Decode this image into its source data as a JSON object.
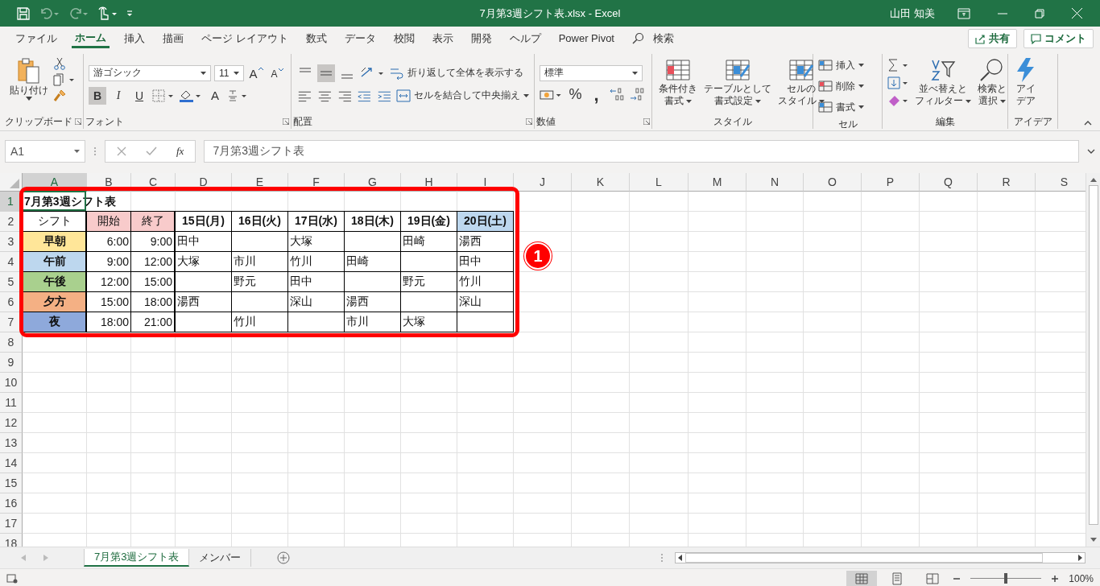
{
  "title_bar": {
    "title": "7月第3週シフト表.xlsx  -  Excel",
    "user": "山田 知美"
  },
  "menu_tabs": [
    {
      "label": "ファイル",
      "selected": false
    },
    {
      "label": "ホーム",
      "selected": true
    },
    {
      "label": "挿入",
      "selected": false
    },
    {
      "label": "描画",
      "selected": false
    },
    {
      "label": "ページ レイアウト",
      "selected": false
    },
    {
      "label": "数式",
      "selected": false
    },
    {
      "label": "データ",
      "selected": false
    },
    {
      "label": "校閲",
      "selected": false
    },
    {
      "label": "表示",
      "selected": false
    },
    {
      "label": "開発",
      "selected": false
    },
    {
      "label": "ヘルプ",
      "selected": false
    },
    {
      "label": "Power Pivot",
      "selected": false
    }
  ],
  "search": {
    "label": "検索"
  },
  "share_button": "共有",
  "comment_button": "コメント",
  "ribbon": {
    "clipboard": {
      "paste": "貼り付け",
      "label": "クリップボード"
    },
    "font": {
      "name": "游ゴシック",
      "size": "11",
      "grow": "A",
      "shrink": "A",
      "bold": {
        "label": "B",
        "on": true
      },
      "italic": {
        "label": "I",
        "on": false
      },
      "underline": {
        "label": "U",
        "on": false
      },
      "font_color": "A",
      "label": "フォント"
    },
    "alignment": {
      "vertical_align": [
        {
          "selected": false
        },
        {
          "selected": true
        },
        {
          "selected": false
        }
      ],
      "wrap": "折り返して全体を表示する",
      "merge": "セルを結合して中央揃え",
      "label": "配置"
    },
    "number": {
      "format": "標準",
      "percent": "%",
      "comma": ",",
      "label": "数値"
    },
    "styles": {
      "buttons": [
        {
          "lines": [
            "条件付き",
            "書式"
          ]
        },
        {
          "lines": [
            "テーブルとして",
            "書式設定"
          ]
        },
        {
          "lines": [
            "セルの",
            "スタイル"
          ]
        }
      ],
      "label": "スタイル"
    },
    "cells": {
      "buttons": [
        "挿入",
        "削除",
        "書式"
      ],
      "label": "セル"
    },
    "editing": {
      "buttons": [
        {
          "lines": [
            "並べ替えと",
            "フィルター"
          ]
        },
        {
          "lines": [
            "検索と",
            "選択"
          ]
        }
      ],
      "label": "編集"
    },
    "ideas": {
      "lines": [
        "アイ",
        "デア"
      ],
      "label": "アイデア"
    }
  },
  "formula_bar": {
    "name_box": "A1",
    "function_label": "fx",
    "formula": "7月第3週シフト表"
  },
  "sheet": {
    "columns": [
      {
        "label": "A",
        "selected": true
      },
      {
        "label": "B",
        "selected": false
      },
      {
        "label": "C",
        "selected": false
      },
      {
        "label": "D",
        "selected": false
      },
      {
        "label": "E",
        "selected": false
      },
      {
        "label": "F",
        "selected": false
      },
      {
        "label": "G",
        "selected": false
      },
      {
        "label": "H",
        "selected": false
      },
      {
        "label": "I",
        "selected": false
      },
      {
        "label": "J",
        "selected": false
      },
      {
        "label": "K",
        "selected": false
      },
      {
        "label": "L",
        "selected": false
      },
      {
        "label": "M",
        "selected": false
      },
      {
        "label": "N",
        "selected": false
      },
      {
        "label": "O",
        "selected": false
      },
      {
        "label": "P",
        "selected": false
      },
      {
        "label": "Q",
        "selected": false
      },
      {
        "label": "R",
        "selected": false
      },
      {
        "label": "S",
        "selected": false
      }
    ],
    "rows": [
      {
        "label": "1",
        "selected": true
      },
      {
        "label": "2",
        "selected": false
      },
      {
        "label": "3",
        "selected": false
      },
      {
        "label": "4",
        "selected": false
      },
      {
        "label": "5",
        "selected": false
      },
      {
        "label": "6",
        "selected": false
      },
      {
        "label": "7",
        "selected": false
      },
      {
        "label": "8",
        "selected": false
      },
      {
        "label": "9",
        "selected": false
      },
      {
        "label": "10",
        "selected": false
      },
      {
        "label": "11",
        "selected": false
      },
      {
        "label": "12",
        "selected": false
      },
      {
        "label": "13",
        "selected": false
      },
      {
        "label": "14",
        "selected": false
      },
      {
        "label": "15",
        "selected": false
      },
      {
        "label": "16",
        "selected": false
      },
      {
        "label": "17",
        "selected": false
      },
      {
        "label": "18",
        "selected": false
      }
    ],
    "table": {
      "title": "7月第3週シフト表",
      "header": [
        {
          "kind": "field",
          "label": "シフト"
        },
        {
          "kind": "field",
          "label": "開始",
          "color": "#f8cbcb"
        },
        {
          "kind": "field",
          "label": "終了",
          "color": "#f8cbcb"
        },
        {
          "kind": "day",
          "label": "15日(月)"
        },
        {
          "kind": "day",
          "label": "16日(火)"
        },
        {
          "kind": "day",
          "label": "17日(水)"
        },
        {
          "kind": "day",
          "label": "18日(木)"
        },
        {
          "kind": "day",
          "label": "19日(金)"
        },
        {
          "kind": "day",
          "label": "20日(土)",
          "color": "#bdd7ee"
        }
      ],
      "shifts": [
        {
          "name": "早朝",
          "color": "#ffe699",
          "start": "6:00",
          "end": "9:00",
          "staff": [
            {
              "kind": "name",
              "name": "田中"
            },
            {
              "kind": "empty"
            },
            {
              "kind": "name",
              "name": "大塚"
            },
            {
              "kind": "empty"
            },
            {
              "kind": "name",
              "name": "田崎"
            },
            {
              "kind": "name",
              "name": "湯西"
            }
          ]
        },
        {
          "name": "午前",
          "color": "#bdd7ee",
          "start": "9:00",
          "end": "12:00",
          "staff": [
            {
              "kind": "name",
              "name": "大塚"
            },
            {
              "kind": "name",
              "name": "市川"
            },
            {
              "kind": "name",
              "name": "竹川"
            },
            {
              "kind": "name",
              "name": "田崎"
            },
            {
              "kind": "empty"
            },
            {
              "kind": "name",
              "name": "田中"
            }
          ]
        },
        {
          "name": "午後",
          "color": "#a9d08e",
          "start": "12:00",
          "end": "15:00",
          "staff": [
            {
              "kind": "empty"
            },
            {
              "kind": "name",
              "name": "野元"
            },
            {
              "kind": "name",
              "name": "田中"
            },
            {
              "kind": "empty"
            },
            {
              "kind": "name",
              "name": "野元"
            },
            {
              "kind": "name",
              "name": "竹川"
            }
          ]
        },
        {
          "name": "夕方",
          "color": "#f4b084",
          "start": "15:00",
          "end": "18:00",
          "staff": [
            {
              "kind": "name",
              "name": "湯西"
            },
            {
              "kind": "empty"
            },
            {
              "kind": "name",
              "name": "深山"
            },
            {
              "kind": "name",
              "name": "湯西"
            },
            {
              "kind": "empty"
            },
            {
              "kind": "name",
              "name": "深山"
            }
          ]
        },
        {
          "name": "夜",
          "color": "#8ea9db",
          "start": "18:00",
          "end": "21:00",
          "staff": [
            {
              "kind": "empty"
            },
            {
              "kind": "name",
              "name": "竹川"
            },
            {
              "kind": "empty"
            },
            {
              "kind": "name",
              "name": "市川"
            },
            {
              "kind": "name",
              "name": "大塚"
            },
            {
              "kind": "empty"
            }
          ]
        }
      ]
    }
  },
  "annotation": {
    "label": "1"
  },
  "sheet_tabs": [
    {
      "label": "7月第3週シフト表",
      "selected": true
    },
    {
      "label": "メンバー",
      "selected": false
    }
  ],
  "status_bar": {
    "views": [
      {
        "selected": true
      },
      {
        "selected": false
      },
      {
        "selected": false
      }
    ],
    "zoom": {
      "level": 0.5,
      "reading": "100%"
    }
  }
}
